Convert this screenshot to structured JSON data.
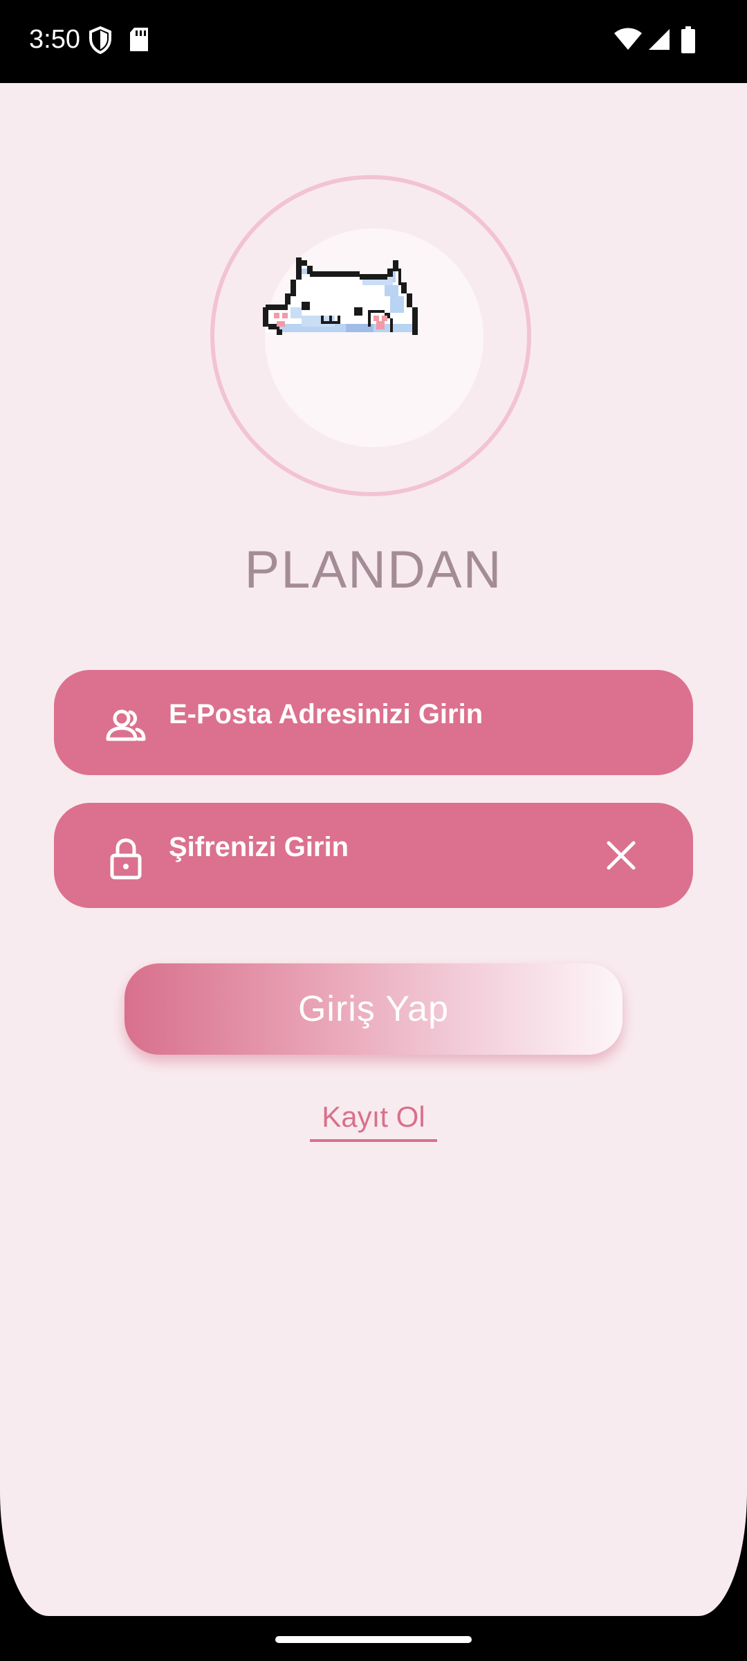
{
  "status_bar": {
    "time": "3:50",
    "icons": [
      "shield-icon",
      "sd-card-icon",
      "wifi-icon",
      "signal-icon",
      "battery-icon"
    ]
  },
  "app": {
    "title": "PLANDAN",
    "logo": "pixel-cat-icon",
    "email": {
      "placeholder": "E-Posta Adresinizi Girin",
      "value": "",
      "icon": "users-icon"
    },
    "password": {
      "placeholder": "Şifrenizi Girin",
      "value": "",
      "icon": "lock-icon",
      "trailing_icon": "close-icon"
    },
    "login_label": "Giriş Yap",
    "register_label": "Kayıt Ol"
  },
  "colors": {
    "background": "#f8ebef",
    "field": "#db718e",
    "accent": "#d8708c",
    "title": "#a48c96",
    "ring": "#f2c3d1"
  }
}
